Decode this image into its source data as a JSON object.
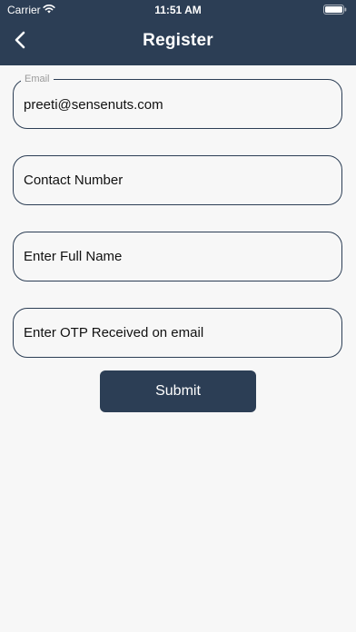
{
  "status_bar": {
    "carrier": "Carrier",
    "time": "11:51 AM",
    "wifi_icon": "wifi-icon",
    "battery_icon": "battery-icon"
  },
  "nav": {
    "title": "Register",
    "back_icon": "chevron-left-icon"
  },
  "form": {
    "email": {
      "label": "Email",
      "value": "preeti@sensenuts.com",
      "placeholder": ""
    },
    "contact": {
      "placeholder": "Contact Number",
      "value": ""
    },
    "full_name": {
      "placeholder": "Enter Full Name",
      "value": ""
    },
    "otp": {
      "placeholder": "Enter OTP Received on email",
      "value": ""
    },
    "submit_label": "Submit"
  },
  "colors": {
    "primary": "#2c3e55",
    "background": "#f7f7f7",
    "label_gray": "#9a9a9a"
  }
}
